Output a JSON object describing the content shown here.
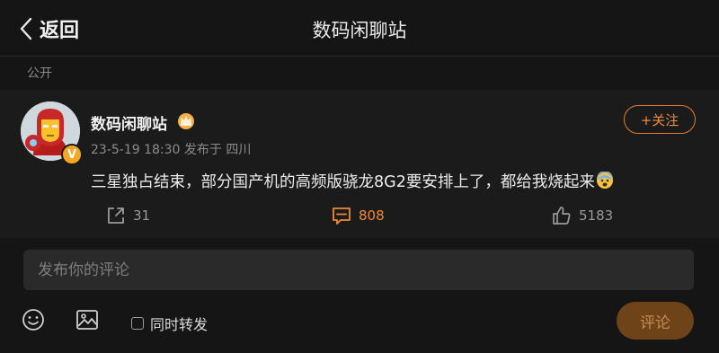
{
  "nav": {
    "back_label": "返回",
    "title": "数码闲聊站"
  },
  "visibility": "公开",
  "post": {
    "author": "数码闲聊站",
    "verified_badge": "V",
    "meta": "23-5-19 18:30 发布于 四川",
    "follow_label": "+关注",
    "text": "三星独占结束，部分国产机的高频版骁龙8G2要安排上了，都给我烧起来",
    "emoji": "hot-face-emoji",
    "actions": {
      "repost_count": "31",
      "comment_count": "808",
      "like_count": "5183"
    }
  },
  "composer": {
    "placeholder": "发布你的评论",
    "repost_label": "同时转发",
    "submit_label": "评论"
  },
  "colors": {
    "background": "#151515",
    "card": "#1b1b1b",
    "accent": "#f08a35",
    "badge": "#f5a623",
    "submit_bg": "#6e4318"
  }
}
